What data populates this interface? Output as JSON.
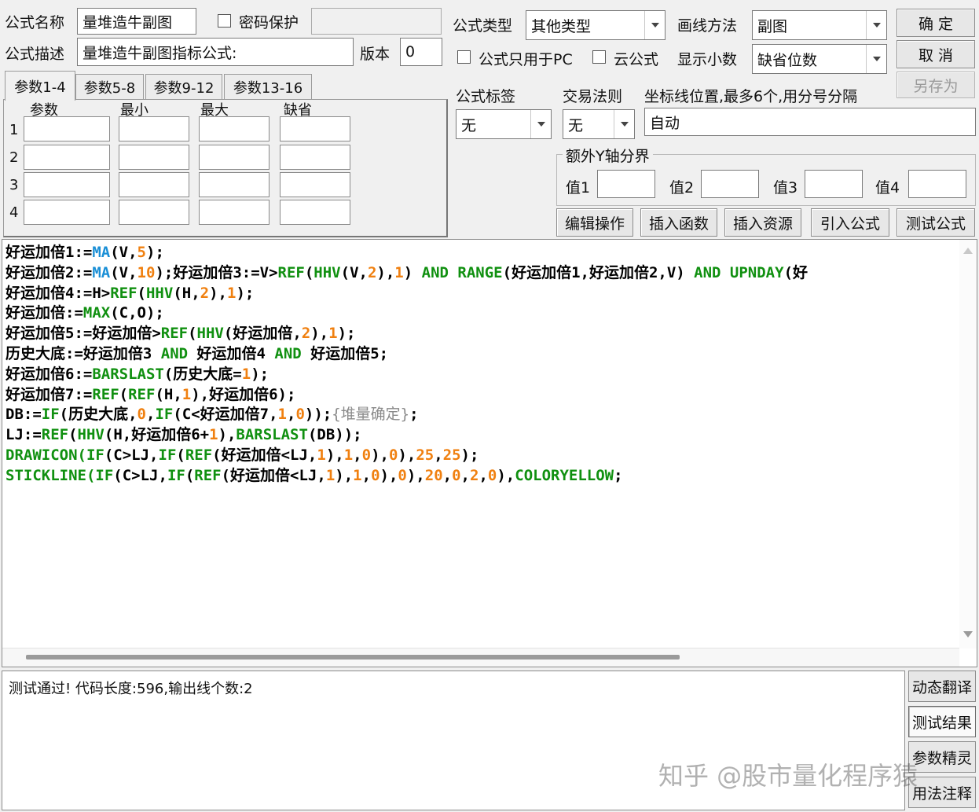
{
  "header": {
    "formula_name_label": "公式名称",
    "formula_name_value": "量堆造牛副图",
    "password_label": "密码保护",
    "password_checked": false,
    "formula_desc_label": "公式描述",
    "formula_desc_value": "量堆造牛副图指标公式:",
    "version_label": "版本",
    "version_value": "0",
    "formula_type_label": "公式类型",
    "formula_type_value": "其他类型",
    "draw_method_label": "画线方法",
    "draw_method_value": "副图",
    "pc_only_label": "公式只用于PC",
    "pc_only_checked": false,
    "cloud_label": "云公式",
    "cloud_checked": false,
    "decimal_label": "显示小数",
    "decimal_value": "缺省位数",
    "tag_label": "公式标签",
    "tag_value": "无",
    "trade_rule_label": "交易法则",
    "trade_rule_value": "无",
    "coord_label": "坐标线位置,最多6个,用分号分隔",
    "coord_value": "自动"
  },
  "buttons": {
    "ok": "确  定",
    "cancel": "取  消",
    "save_as": "另存为",
    "edit_op": "编辑操作",
    "insert_func": "插入函数",
    "insert_res": "插入资源",
    "import_formula": "引入公式",
    "test_formula": "测试公式"
  },
  "param_tabs": [
    "参数1-4",
    "参数5-8",
    "参数9-12",
    "参数13-16"
  ],
  "param_headers": [
    "参数",
    "最小",
    "最大",
    "缺省"
  ],
  "param_rows": [
    "1",
    "2",
    "3",
    "4"
  ],
  "y_axis": {
    "title": "额外Y轴分界",
    "labels": [
      "值1",
      "值2",
      "值3",
      "值4"
    ]
  },
  "code_lines": [
    [
      {
        "t": "好运加倍1:=",
        "c": "k"
      },
      {
        "t": "MA",
        "c": "f"
      },
      {
        "t": "(V,",
        "c": "k"
      },
      {
        "t": "5",
        "c": "n"
      },
      {
        "t": ");",
        "c": "k"
      }
    ],
    [
      {
        "t": "好运加倍2:=",
        "c": "k"
      },
      {
        "t": "MA",
        "c": "f"
      },
      {
        "t": "(V,",
        "c": "k"
      },
      {
        "t": "10",
        "c": "n"
      },
      {
        "t": ");好运加倍3:=V>",
        "c": "k"
      },
      {
        "t": "REF",
        "c": "g"
      },
      {
        "t": "(",
        "c": "k"
      },
      {
        "t": "HHV",
        "c": "g"
      },
      {
        "t": "(V,",
        "c": "k"
      },
      {
        "t": "2",
        "c": "n"
      },
      {
        "t": "),",
        "c": "k"
      },
      {
        "t": "1",
        "c": "n"
      },
      {
        "t": ") ",
        "c": "k"
      },
      {
        "t": "AND",
        "c": "g"
      },
      {
        "t": " ",
        "c": "k"
      },
      {
        "t": "RANGE",
        "c": "g"
      },
      {
        "t": "(好运加倍1,好运加倍2,V) ",
        "c": "k"
      },
      {
        "t": "AND",
        "c": "g"
      },
      {
        "t": " ",
        "c": "k"
      },
      {
        "t": "UPNDAY",
        "c": "g"
      },
      {
        "t": "(好",
        "c": "k"
      }
    ],
    [
      {
        "t": "好运加倍4:=H>",
        "c": "k"
      },
      {
        "t": "REF",
        "c": "g"
      },
      {
        "t": "(",
        "c": "k"
      },
      {
        "t": "HHV",
        "c": "g"
      },
      {
        "t": "(H,",
        "c": "k"
      },
      {
        "t": "2",
        "c": "n"
      },
      {
        "t": "),",
        "c": "k"
      },
      {
        "t": "1",
        "c": "n"
      },
      {
        "t": ");",
        "c": "k"
      }
    ],
    [
      {
        "t": "好运加倍:=",
        "c": "k"
      },
      {
        "t": "MAX",
        "c": "g"
      },
      {
        "t": "(C,O);",
        "c": "k"
      }
    ],
    [
      {
        "t": "好运加倍5:=好运加倍>",
        "c": "k"
      },
      {
        "t": "REF",
        "c": "g"
      },
      {
        "t": "(",
        "c": "k"
      },
      {
        "t": "HHV",
        "c": "g"
      },
      {
        "t": "(好运加倍,",
        "c": "k"
      },
      {
        "t": "2",
        "c": "n"
      },
      {
        "t": "),",
        "c": "k"
      },
      {
        "t": "1",
        "c": "n"
      },
      {
        "t": ");",
        "c": "k"
      }
    ],
    [
      {
        "t": "历史大底:=好运加倍3 ",
        "c": "k"
      },
      {
        "t": "AND",
        "c": "g"
      },
      {
        "t": " 好运加倍4 ",
        "c": "k"
      },
      {
        "t": "AND",
        "c": "g"
      },
      {
        "t": " 好运加倍5;",
        "c": "k"
      }
    ],
    [
      {
        "t": "好运加倍6:=",
        "c": "k"
      },
      {
        "t": "BARSLAST",
        "c": "g"
      },
      {
        "t": "(历史大底=",
        "c": "k"
      },
      {
        "t": "1",
        "c": "n"
      },
      {
        "t": ");",
        "c": "k"
      }
    ],
    [
      {
        "t": "好运加倍7:=",
        "c": "k"
      },
      {
        "t": "REF",
        "c": "g"
      },
      {
        "t": "(",
        "c": "k"
      },
      {
        "t": "REF",
        "c": "g"
      },
      {
        "t": "(H,",
        "c": "k"
      },
      {
        "t": "1",
        "c": "n"
      },
      {
        "t": "),好运加倍6);",
        "c": "k"
      }
    ],
    [
      {
        "t": "DB:=",
        "c": "k"
      },
      {
        "t": "IF",
        "c": "g"
      },
      {
        "t": "(历史大底,",
        "c": "k"
      },
      {
        "t": "0",
        "c": "n"
      },
      {
        "t": ",",
        "c": "k"
      },
      {
        "t": "IF",
        "c": "g"
      },
      {
        "t": "(C<好运加倍7,",
        "c": "k"
      },
      {
        "t": "1",
        "c": "n"
      },
      {
        "t": ",",
        "c": "k"
      },
      {
        "t": "0",
        "c": "n"
      },
      {
        "t": "));",
        "c": "k"
      },
      {
        "t": "{堆量确定}",
        "c": "m"
      },
      {
        "t": ";",
        "c": "k"
      }
    ],
    [
      {
        "t": "LJ:=",
        "c": "k"
      },
      {
        "t": "REF",
        "c": "g"
      },
      {
        "t": "(",
        "c": "k"
      },
      {
        "t": "HHV",
        "c": "g"
      },
      {
        "t": "(H,好运加倍6+",
        "c": "k"
      },
      {
        "t": "1",
        "c": "n"
      },
      {
        "t": "),",
        "c": "k"
      },
      {
        "t": "BARSLAST",
        "c": "g"
      },
      {
        "t": "(DB));",
        "c": "k"
      }
    ],
    [
      {
        "t": "DRAWICON",
        "c": "g"
      },
      {
        "t": "(",
        "c": "g"
      },
      {
        "t": "IF",
        "c": "g"
      },
      {
        "t": "(C>LJ,",
        "c": "k"
      },
      {
        "t": "IF",
        "c": "g"
      },
      {
        "t": "(",
        "c": "k"
      },
      {
        "t": "REF",
        "c": "g"
      },
      {
        "t": "(好运加倍<LJ,",
        "c": "k"
      },
      {
        "t": "1",
        "c": "n"
      },
      {
        "t": "),",
        "c": "k"
      },
      {
        "t": "1",
        "c": "n"
      },
      {
        "t": ",",
        "c": "k"
      },
      {
        "t": "0",
        "c": "n"
      },
      {
        "t": "),",
        "c": "k"
      },
      {
        "t": "0",
        "c": "n"
      },
      {
        "t": "),",
        "c": "k"
      },
      {
        "t": "25",
        "c": "n"
      },
      {
        "t": ",",
        "c": "k"
      },
      {
        "t": "25",
        "c": "n"
      },
      {
        "t": ");",
        "c": "k"
      }
    ],
    [
      {
        "t": "STICKLINE",
        "c": "g"
      },
      {
        "t": "(",
        "c": "g"
      },
      {
        "t": "IF",
        "c": "g"
      },
      {
        "t": "(C>LJ,",
        "c": "k"
      },
      {
        "t": "IF",
        "c": "g"
      },
      {
        "t": "(",
        "c": "k"
      },
      {
        "t": "REF",
        "c": "g"
      },
      {
        "t": "(好运加倍<LJ,",
        "c": "k"
      },
      {
        "t": "1",
        "c": "n"
      },
      {
        "t": "),",
        "c": "k"
      },
      {
        "t": "1",
        "c": "n"
      },
      {
        "t": ",",
        "c": "k"
      },
      {
        "t": "0",
        "c": "n"
      },
      {
        "t": "),",
        "c": "k"
      },
      {
        "t": "0",
        "c": "n"
      },
      {
        "t": "),",
        "c": "k"
      },
      {
        "t": "20",
        "c": "n"
      },
      {
        "t": ",",
        "c": "k"
      },
      {
        "t": "0",
        "c": "n"
      },
      {
        "t": ",",
        "c": "k"
      },
      {
        "t": "2",
        "c": "n"
      },
      {
        "t": ",",
        "c": "k"
      },
      {
        "t": "0",
        "c": "n"
      },
      {
        "t": "),",
        "c": "k"
      },
      {
        "t": "COLORYELLOW",
        "c": "g"
      },
      {
        "t": ";",
        "c": "k"
      }
    ]
  ],
  "syntax_colors": {
    "k": "#000000",
    "f": "#1a8fd6",
    "g": "#109010",
    "n": "#f08010",
    "m": "#8a8a8a"
  },
  "output_text": "测试通过! 代码长度:596,输出线个数:2",
  "side_buttons": [
    "动态翻译",
    "测试结果",
    "参数精灵",
    "用法注释"
  ],
  "watermark": "知乎 @股市量化程序猿"
}
